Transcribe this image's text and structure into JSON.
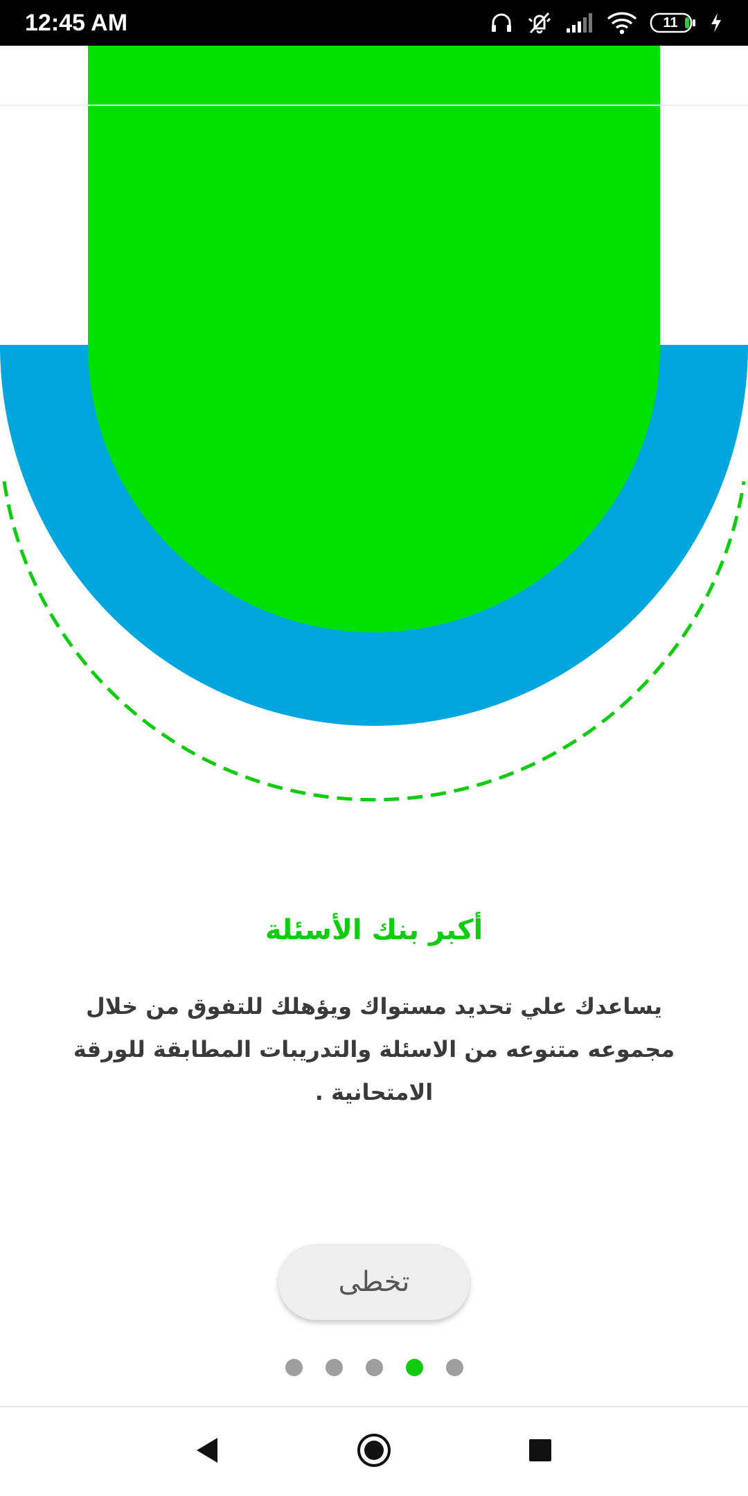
{
  "status_bar": {
    "time": "12:45 AM",
    "battery_level": "11",
    "icons": [
      "headphones-icon",
      "vibrate-off-icon",
      "signal-icon",
      "wifi-icon",
      "battery-icon",
      "charging-icon"
    ]
  },
  "onboarding": {
    "title": "أكبر بنك الأسئلة",
    "description": "يساعدك علي تحديد مستواك ويؤهلك للتفوق من خلال مجموعه متنوعه من الاسئلة والتدريبات المطابقة للورقة الامتحانية .",
    "skip_label": "تخطى",
    "page_count": 5,
    "active_page": 4
  },
  "nav_bar": {
    "icons": [
      "back-icon",
      "home-icon",
      "recents-icon"
    ]
  },
  "colors": {
    "accent_green": "#00E100",
    "title_green": "#10CC10",
    "hero_blue": "#00A6DD",
    "dot_inactive": "#9E9E9E",
    "status_bar": "#000000"
  }
}
